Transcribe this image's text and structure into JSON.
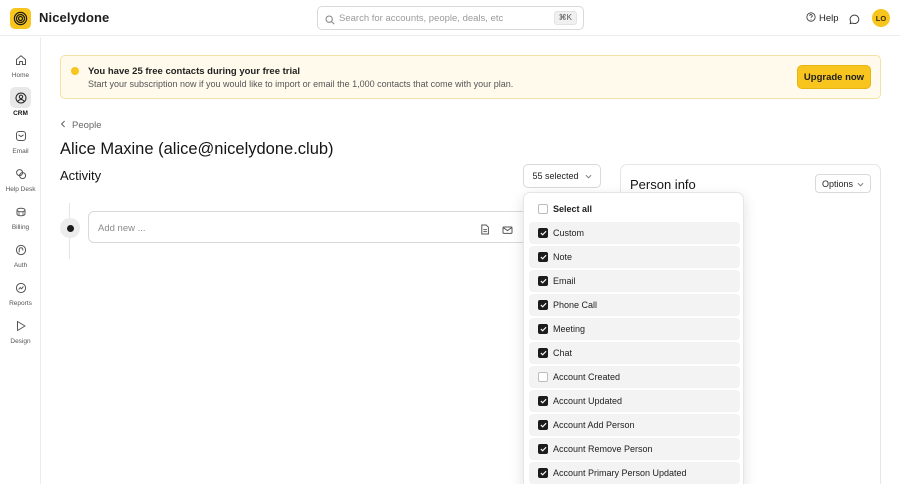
{
  "app": {
    "name": "Nicelydone",
    "avatar_initials": "LO",
    "help_label": "Help"
  },
  "search": {
    "placeholder": "Search for accounts, people, deals, etc",
    "shortcut": "⌘K"
  },
  "sidebar": {
    "items": [
      {
        "label": "Home",
        "icon": "home-icon",
        "active": false
      },
      {
        "label": "CRM",
        "icon": "crm-icon",
        "active": true
      },
      {
        "label": "Email",
        "icon": "email-icon",
        "active": false
      },
      {
        "label": "Help Desk",
        "icon": "help-desk-icon",
        "active": false
      },
      {
        "label": "Billing",
        "icon": "billing-icon",
        "active": false
      },
      {
        "label": "Auth",
        "icon": "auth-icon",
        "active": false
      },
      {
        "label": "Reports",
        "icon": "reports-icon",
        "active": false
      },
      {
        "label": "Design",
        "icon": "design-icon",
        "active": false
      }
    ]
  },
  "banner": {
    "title": "You have 25 free contacts during your free trial",
    "text": "Start your subscription now if you would like to import or email the 1,000 contacts that come with your plan.",
    "button_label": "Upgrade now"
  },
  "breadcrumb": {
    "label": "People"
  },
  "page": {
    "title": "Alice Maxine (alice@nicelydone.club)",
    "section_title": "Activity"
  },
  "activity": {
    "selected_label": "55 selected",
    "add_placeholder": "Add new ..."
  },
  "person_info": {
    "title": "Person info",
    "options_label": "Options"
  },
  "dropdown": {
    "select_all_label": "Select all",
    "items": [
      {
        "label": "Custom",
        "checked": true
      },
      {
        "label": "Note",
        "checked": true
      },
      {
        "label": "Email",
        "checked": true
      },
      {
        "label": "Phone Call",
        "checked": true
      },
      {
        "label": "Meeting",
        "checked": true
      },
      {
        "label": "Chat",
        "checked": true
      },
      {
        "label": "Account Created",
        "checked": false
      },
      {
        "label": "Account Updated",
        "checked": true
      },
      {
        "label": "Account Add Person",
        "checked": true
      },
      {
        "label": "Account Remove Person",
        "checked": true
      },
      {
        "label": "Account Primary Person Updated",
        "checked": true
      }
    ]
  },
  "colors": {
    "accent": "#f7c51d",
    "banner_bg": "#fffaec",
    "checkbox": "#1c1c1c"
  }
}
